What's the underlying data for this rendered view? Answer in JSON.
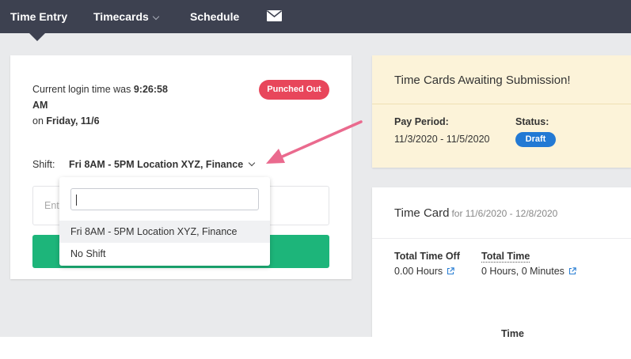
{
  "nav": {
    "items": [
      {
        "label": "Time Entry"
      },
      {
        "label": "Timecards"
      },
      {
        "label": "Schedule"
      }
    ],
    "mail_icon": "envelope-icon"
  },
  "punch": {
    "login_prefix": "Current login time was ",
    "login_time": "9:26:58 AM",
    "login_on": "on ",
    "login_date": "Friday, 11/6",
    "status": "Punched Out",
    "shift_label": "Shift:",
    "shift_value": "Fri 8AM - 5PM Location XYZ, Finance",
    "entry_placeholder": "Ente",
    "dropdown_search_value": "",
    "dropdown_options": [
      {
        "label": "Fri 8AM - 5PM Location XYZ, Finance"
      },
      {
        "label": "No Shift"
      }
    ]
  },
  "awaiting": {
    "title": "Time Cards Awaiting Submission!",
    "pay_period_label": "Pay Period:",
    "pay_period_value": "11/3/2020 - 11/5/2020",
    "status_label": "Status:",
    "status_value": "Draft"
  },
  "timecard": {
    "title": "Time Card",
    "range": "for 11/6/2020 - 12/8/2020",
    "total_time_off_label": "Total Time Off",
    "total_time_off_value": "0.00 Hours",
    "total_time_label": "Total Time",
    "total_time_value": "0 Hours, 0 Minutes",
    "table_header_time": "Time"
  },
  "colors": {
    "nav_bg": "#3d4150",
    "badge_red": "#e8465b",
    "button_green": "#1db57a",
    "draft_blue": "#2279d4",
    "awaiting_bg": "#fcf3d9",
    "annotation_arrow": "#ea6a8e"
  }
}
